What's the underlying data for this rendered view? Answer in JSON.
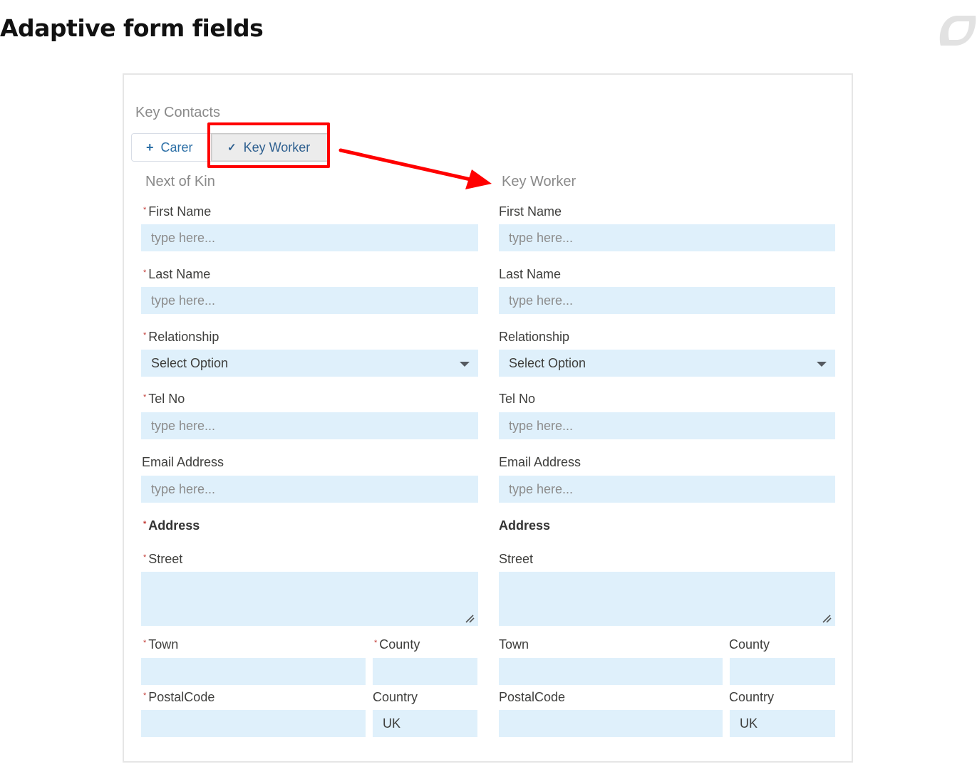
{
  "page": {
    "title": "Adaptive form fields",
    "logo_icon": "brand-logo-icon"
  },
  "form": {
    "section_title": "Key Contacts",
    "buttons": {
      "carer": {
        "label": "Carer",
        "icon": "plus-icon",
        "icon_glyph": "+"
      },
      "key_worker": {
        "label": "Key Worker",
        "icon": "check-icon",
        "icon_glyph": "✓",
        "selected": true
      }
    },
    "annotation": {
      "highlight_color": "#ff0000",
      "arrow_color": "#ff0000"
    },
    "columns": [
      {
        "heading": "Next of Kin",
        "first_name": {
          "label": "First Name",
          "required": true,
          "placeholder": "type here..."
        },
        "last_name": {
          "label": "Last Name",
          "required": true,
          "placeholder": "type here..."
        },
        "relationship": {
          "label": "Relationship",
          "required": true,
          "value": "Select Option"
        },
        "tel_no": {
          "label": "Tel No",
          "required": true,
          "placeholder": "type here..."
        },
        "email": {
          "label": "Email Address",
          "required": false,
          "placeholder": "type here..."
        },
        "address": {
          "label": "Address",
          "required": true
        },
        "street": {
          "label": "Street",
          "required": true,
          "value": ""
        },
        "town": {
          "label": "Town",
          "required": true,
          "value": ""
        },
        "county": {
          "label": "County",
          "required": true,
          "value": ""
        },
        "postal_code": {
          "label": "PostalCode",
          "required": true,
          "value": ""
        },
        "country": {
          "label": "Country",
          "required": false,
          "value": "UK"
        }
      },
      {
        "heading": "Key Worker",
        "first_name": {
          "label": "First Name",
          "required": false,
          "placeholder": "type here..."
        },
        "last_name": {
          "label": "Last Name",
          "required": false,
          "placeholder": "type here..."
        },
        "relationship": {
          "label": "Relationship",
          "required": false,
          "value": "Select Option"
        },
        "tel_no": {
          "label": "Tel No",
          "required": false,
          "placeholder": "type here..."
        },
        "email": {
          "label": "Email Address",
          "required": false,
          "placeholder": "type here..."
        },
        "address": {
          "label": "Address",
          "required": false
        },
        "street": {
          "label": "Street",
          "required": false,
          "value": ""
        },
        "town": {
          "label": "Town",
          "required": false,
          "value": ""
        },
        "county": {
          "label": "County",
          "required": false,
          "value": ""
        },
        "postal_code": {
          "label": "PostalCode",
          "required": false,
          "value": ""
        },
        "country": {
          "label": "Country",
          "required": false,
          "value": "UK"
        }
      }
    ],
    "required_marker": "*",
    "colors": {
      "input_bg": "#dff0fb",
      "button_text": "#2c6fa6",
      "required_marker": "#c23934"
    }
  }
}
